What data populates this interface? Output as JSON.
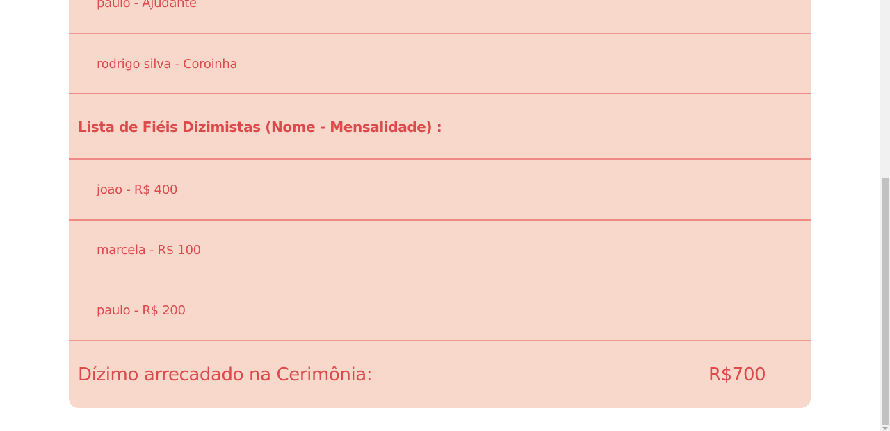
{
  "assistants": [
    {
      "label": "paulo - Ajudante"
    },
    {
      "label": "rodrigo silva - Coroinha"
    }
  ],
  "tithers_heading": "Lista de Fiéis Dizimistas (Nome - Mensalidade) :",
  "tithers": [
    {
      "label": "joao - R$ 400"
    },
    {
      "label": "marcela - R$ 100"
    },
    {
      "label": "paulo - R$ 200"
    }
  ],
  "footer": {
    "label": "Dízimo arrecadado na Cerimônia:",
    "value": "R$700"
  },
  "colors": {
    "background": "#f9d8cc",
    "text": "#dc4a4c",
    "divider": "#ef9a92"
  }
}
